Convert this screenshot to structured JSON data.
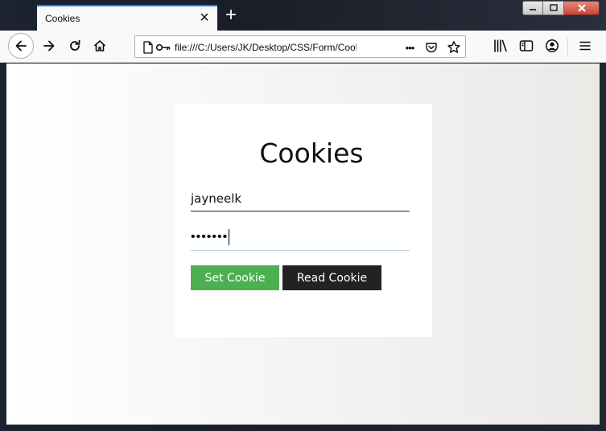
{
  "browser": {
    "tab": {
      "title": "Cookies",
      "close_glyph": "×"
    },
    "new_tab_glyph": "+",
    "url": "file:///C:/Users/JK/Desktop/CSS/Form/Cookies",
    "more_glyph": "•••",
    "icons": {
      "back": "back-arrow-icon",
      "forward": "forward-arrow-icon",
      "reload": "reload-icon",
      "home": "home-icon",
      "page": "page-icon",
      "key": "key-icon",
      "pocket": "pocket-icon",
      "bookmark": "star-icon",
      "library": "library-icon",
      "sidebar": "sidebar-icon",
      "account": "account-icon",
      "menu": "hamburger-menu-icon"
    },
    "colors": {
      "tab_accent": "#0a84ff",
      "toolbar": "#f9f9fa",
      "titlebar": "#1b1f2b"
    }
  },
  "form": {
    "title": "Cookies",
    "username_value": "jayneelk",
    "password_masked": "•••••••",
    "set_button_label": "Set Cookie",
    "read_button_label": "Read Cookie",
    "colors": {
      "set_button": "#4caf50",
      "read_button": "#222222"
    }
  }
}
